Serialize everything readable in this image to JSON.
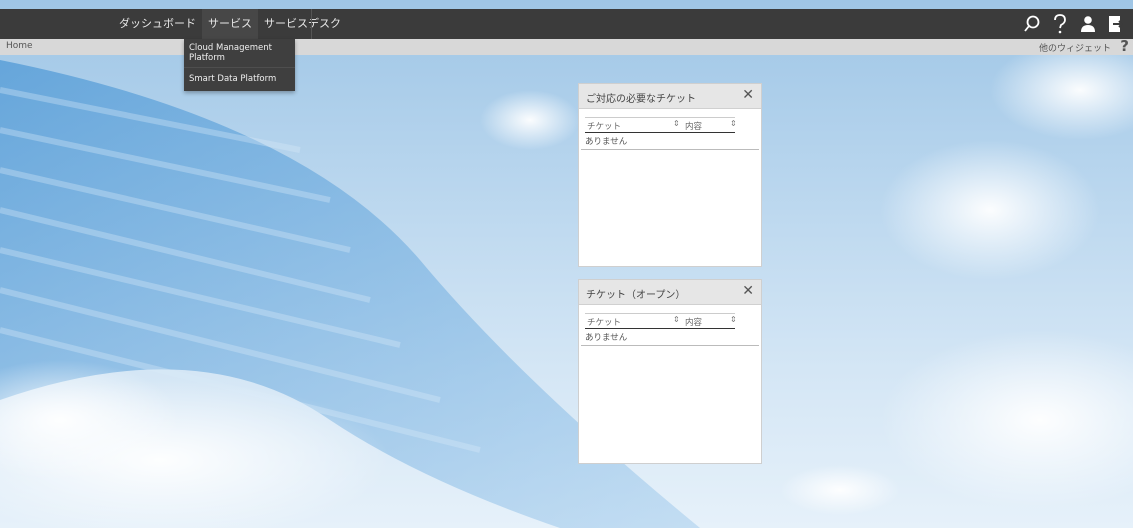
{
  "nav": {
    "items": [
      "ダッシュボード",
      "サービス",
      "サービスデスク"
    ]
  },
  "dropdown": {
    "items": [
      "Cloud Management Platform",
      "Smart Data Platform"
    ]
  },
  "breadcrumb": {
    "home": "Home"
  },
  "toolbar": {
    "other_widgets": "他のウィジェット",
    "help": "?"
  },
  "widgets": [
    {
      "title": "ご対応の必要なチケット",
      "columns": [
        "チケット",
        "内容"
      ],
      "empty": "ありません"
    },
    {
      "title": "チケット（オープン）",
      "columns": [
        "チケット",
        "内容"
      ],
      "empty": "ありません"
    }
  ],
  "icons": {
    "search": "search-icon",
    "help": "help-icon",
    "user": "user-icon",
    "logout": "logout-icon"
  },
  "colors": {
    "topbar": "#3b3b3b",
    "crumbbar": "#d8d8d8"
  }
}
